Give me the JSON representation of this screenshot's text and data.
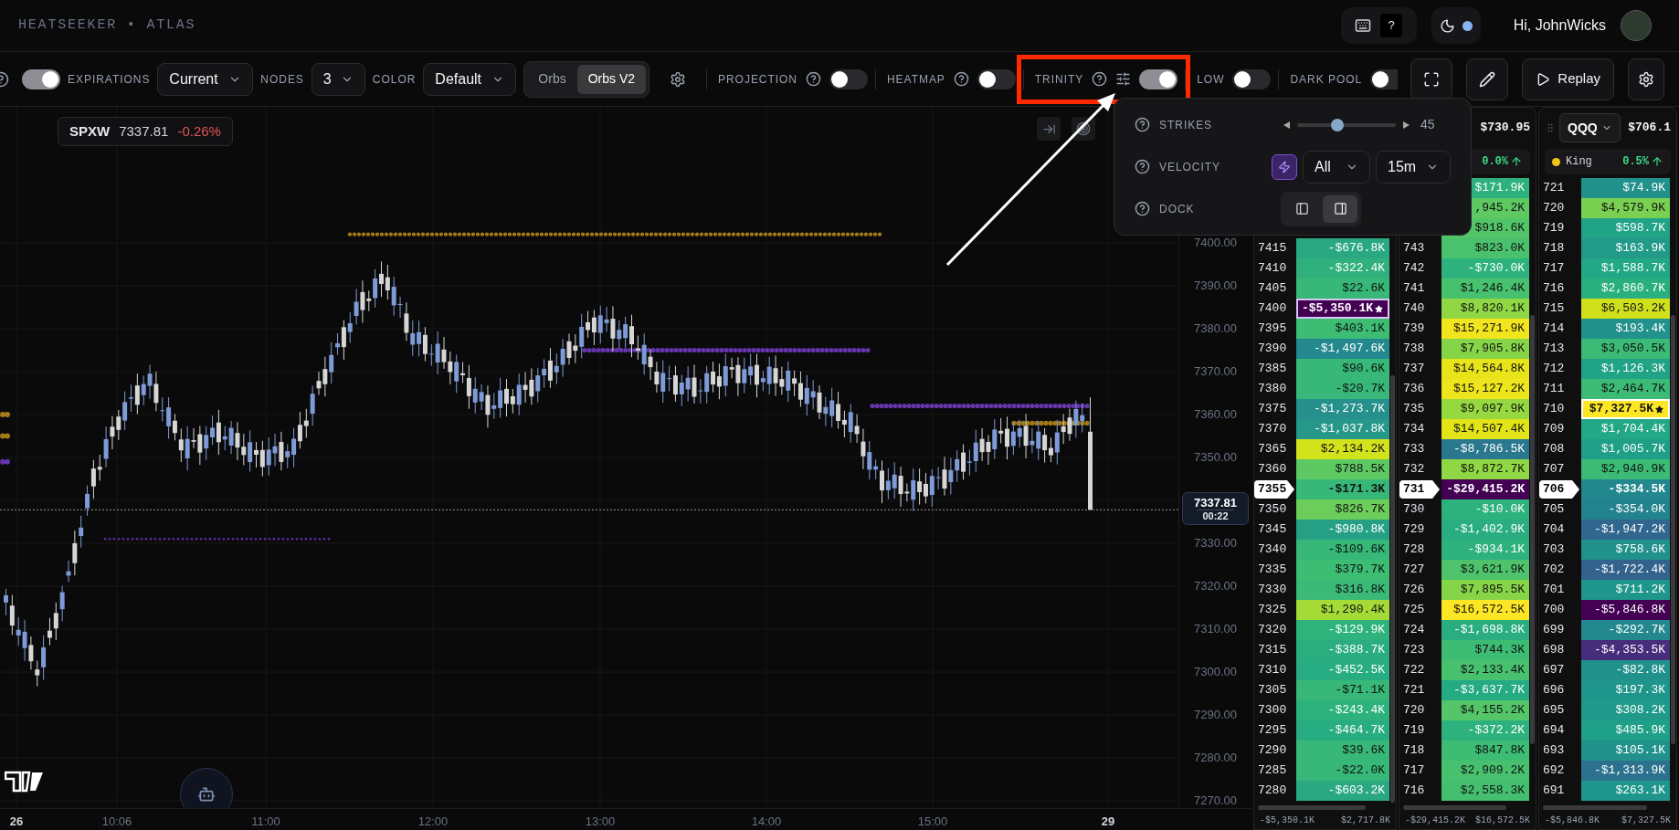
{
  "header": {
    "title": "HEATSEEKER • ATLAS",
    "help_key": "?",
    "greeting": "Hi, JohnWicks"
  },
  "toolbar": {
    "expirations": {
      "label": "EXPIRATIONS",
      "on": true,
      "value": "Current"
    },
    "nodes": {
      "label": "NODES",
      "value": "3"
    },
    "color": {
      "label": "COLOR",
      "value": "Default"
    },
    "modes": [
      {
        "label": "Orbs",
        "selected": false
      },
      {
        "label": "Orbs V2",
        "selected": true
      }
    ],
    "toggles": [
      {
        "label": "PROJECTION",
        "help": true,
        "settings": false,
        "on": false,
        "highlighted": false
      },
      {
        "label": "HEATMAP",
        "help": true,
        "settings": false,
        "on": false,
        "highlighted": false
      },
      {
        "label": "TRINITY",
        "help": true,
        "settings": true,
        "on": true,
        "highlighted": true
      },
      {
        "label": "LOW",
        "help": false,
        "settings": false,
        "on": false,
        "highlighted": false
      },
      {
        "label": "DARK POOL",
        "help": false,
        "settings": false,
        "on": false,
        "highlighted": false
      }
    ],
    "replay": "Replay"
  },
  "annotation": {
    "arrow": true
  },
  "popover": {
    "strikes": {
      "label": "STRIKES",
      "level": 0.41,
      "value": "45"
    },
    "velocity": {
      "label": "VELOCITY",
      "boost": true,
      "filter": "All",
      "window": "15m"
    },
    "dock": {
      "label": "DOCK",
      "options": [
        {
          "kind": "left",
          "selected": false
        },
        {
          "kind": "right",
          "selected": true
        }
      ]
    }
  },
  "chart": {
    "symbol": "SPXW",
    "price": "7337.81",
    "change": "-0.26%",
    "price_axis_upper": [
      "7400.00",
      "7390.00",
      "7380.00",
      "7370.00",
      "7360.00",
      "7350.00"
    ],
    "price_axis_lower": [
      "7330.00",
      "7320.00",
      "7310.00",
      "7300.00",
      "7290.00",
      "7280.00",
      "7270.00"
    ],
    "last_price": "7337.81",
    "countdown": "00:22",
    "time_axis": [
      {
        "label": "26",
        "major": true
      },
      {
        "label": "10:06",
        "major": false
      },
      {
        "label": "11:00",
        "major": false
      },
      {
        "label": "12:00",
        "major": false
      },
      {
        "label": "13:00",
        "major": false
      },
      {
        "label": "14:00",
        "major": false
      },
      {
        "label": "15:00",
        "major": false
      },
      {
        "label": "29",
        "major": true
      }
    ]
  },
  "panels": [
    {
      "rows": [
        {
          "strike": "7415",
          "value": "-$676.8K",
          "color": "#2aa882",
          "current": false,
          "marker": false
        },
        {
          "strike": "7410",
          "value": "-$322.4K",
          "color": "#30b07c",
          "current": false,
          "marker": false
        },
        {
          "strike": "7405",
          "value": "$22.6K",
          "color": "#37b878",
          "current": false,
          "marker": false
        },
        {
          "strike": "7400",
          "value": "-$5,350.1K",
          "color": "#440154",
          "current": false,
          "marker": true
        },
        {
          "strike": "7395",
          "value": "$403.1K",
          "color": "#3dbc74",
          "current": false,
          "marker": false
        },
        {
          "strike": "7390",
          "value": "-$1,497.6K",
          "color": "#23898e",
          "current": false,
          "marker": false
        },
        {
          "strike": "7385",
          "value": "$90.6K",
          "color": "#37b878",
          "current": false,
          "marker": false
        },
        {
          "strike": "7380",
          "value": "-$20.7K",
          "color": "#37b878",
          "current": false,
          "marker": false
        },
        {
          "strike": "7375",
          "value": "-$1,273.7K",
          "color": "#25908c",
          "current": false,
          "marker": false
        },
        {
          "strike": "7370",
          "value": "-$1,037.8K",
          "color": "#26988a",
          "current": false,
          "marker": false
        },
        {
          "strike": "7365",
          "value": "$2,134.2K",
          "color": "#d2e21b",
          "current": false,
          "marker": false
        },
        {
          "strike": "7360",
          "value": "$788.5K",
          "color": "#5ec962",
          "current": false,
          "marker": false
        },
        {
          "strike": "7355",
          "value": "-$171.3K",
          "color": "#37b878",
          "current": true,
          "marker": false
        },
        {
          "strike": "7350",
          "value": "$826.7K",
          "color": "#6ccd5a",
          "current": false,
          "marker": false
        },
        {
          "strike": "7345",
          "value": "-$980.8K",
          "color": "#25a085",
          "current": false,
          "marker": false
        },
        {
          "strike": "7340",
          "value": "-$109.6K",
          "color": "#37b878",
          "current": false,
          "marker": false
        },
        {
          "strike": "7335",
          "value": "$379.7K",
          "color": "#3dbc74",
          "current": false,
          "marker": false
        },
        {
          "strike": "7330",
          "value": "$316.8K",
          "color": "#3aba76",
          "current": false,
          "marker": false
        },
        {
          "strike": "7325",
          "value": "$1,290.4K",
          "color": "#a5db36",
          "current": false,
          "marker": false
        },
        {
          "strike": "7320",
          "value": "-$129.9K",
          "color": "#2eb37c",
          "current": false,
          "marker": false
        },
        {
          "strike": "7315",
          "value": "-$388.7K",
          "color": "#2aae80",
          "current": false,
          "marker": false
        },
        {
          "strike": "7310",
          "value": "-$452.5K",
          "color": "#28ac81",
          "current": false,
          "marker": false
        },
        {
          "strike": "7305",
          "value": "-$71.1K",
          "color": "#37b878",
          "current": false,
          "marker": false
        },
        {
          "strike": "7300",
          "value": "-$243.4K",
          "color": "#2db27d",
          "current": false,
          "marker": false
        },
        {
          "strike": "7295",
          "value": "-$464.7K",
          "color": "#28ac81",
          "current": false,
          "marker": false
        },
        {
          "strike": "7290",
          "value": "$39.6K",
          "color": "#37b878",
          "current": false,
          "marker": false
        },
        {
          "strike": "7285",
          "value": "-$22.0K",
          "color": "#37b878",
          "current": false,
          "marker": false
        },
        {
          "strike": "7280",
          "value": "-$603.2K",
          "color": "#2aa882",
          "current": false,
          "marker": false
        }
      ],
      "footer_min": "-$5,350.1K",
      "footer_max": "$2,717.8K"
    },
    {
      "price": "$730.95",
      "change": "0.0%",
      "rows": [
        {
          "value": "$171.9K",
          "color": "#2db27d",
          "current": false,
          "marker": false
        },
        {
          "value": ",945.2K",
          "color": "#5ec962",
          "current": false,
          "marker": false
        },
        {
          "value": "$918.6K",
          "color": "#52c569",
          "current": false,
          "marker": false
        },
        {
          "strike": "743",
          "value": "$823.0K",
          "color": "#4ac16d",
          "current": false,
          "marker": false
        },
        {
          "strike": "742",
          "value": "-$730.0K",
          "color": "#2db27d",
          "current": false,
          "marker": false
        },
        {
          "strike": "741",
          "value": "$1,246.4K",
          "color": "#48c16e",
          "current": false,
          "marker": false
        },
        {
          "strike": "740",
          "value": "$8,820.1K",
          "color": "#8fd744",
          "current": false,
          "marker": false
        },
        {
          "strike": "739",
          "value": "$15,271.9K",
          "color": "#f2e51d",
          "current": false,
          "marker": false
        },
        {
          "strike": "738",
          "value": "$7,905.8K",
          "color": "#86d549",
          "current": false,
          "marker": false
        },
        {
          "strike": "737",
          "value": "$14,564.8K",
          "color": "#e7e419",
          "current": false,
          "marker": false
        },
        {
          "strike": "736",
          "value": "$15,127.2K",
          "color": "#efe51c",
          "current": false,
          "marker": false
        },
        {
          "strike": "735",
          "value": "$9,097.9K",
          "color": "#95d840",
          "current": false,
          "marker": false
        },
        {
          "strike": "734",
          "value": "$14,507.4K",
          "color": "#e2e418",
          "current": false,
          "marker": false
        },
        {
          "strike": "733",
          "value": "-$8,786.5K",
          "color": "#2a788e",
          "current": false,
          "marker": false
        },
        {
          "strike": "732",
          "value": "$8,872.7K",
          "color": "#8fd744",
          "current": false,
          "marker": false
        },
        {
          "strike": "731",
          "value": "-$29,415.2K",
          "color": "#440154",
          "current": true,
          "marker": false
        },
        {
          "strike": "730",
          "value": "-$10.0K",
          "color": "#2db27d",
          "current": false,
          "marker": false
        },
        {
          "strike": "729",
          "value": "-$1,402.9K",
          "color": "#2aae80",
          "current": false,
          "marker": false
        },
        {
          "strike": "728",
          "value": "-$934.1K",
          "color": "#2db27d",
          "current": false,
          "marker": false
        },
        {
          "strike": "727",
          "value": "$3,621.9K",
          "color": "#4ec36b",
          "current": false,
          "marker": false
        },
        {
          "strike": "726",
          "value": "$7,895.5K",
          "color": "#86d549",
          "current": false,
          "marker": false
        },
        {
          "strike": "725",
          "value": "$16,572.5K",
          "color": "#fde725",
          "current": false,
          "marker": false
        },
        {
          "strike": "724",
          "value": "-$1,698.8K",
          "color": "#2aae80",
          "current": false,
          "marker": false
        },
        {
          "strike": "723",
          "value": "$744.3K",
          "color": "#3dbc74",
          "current": false,
          "marker": false
        },
        {
          "strike": "722",
          "value": "$2,133.4K",
          "color": "#48c16e",
          "current": false,
          "marker": false
        },
        {
          "strike": "721",
          "value": "-$3,637.7K",
          "color": "#25ab82",
          "current": false,
          "marker": false
        },
        {
          "strike": "720",
          "value": "$4,155.2K",
          "color": "#54c568",
          "current": false,
          "marker": false
        },
        {
          "strike": "719",
          "value": "-$372.2K",
          "color": "#2db27d",
          "current": false,
          "marker": false
        },
        {
          "strike": "718",
          "value": "$847.8K",
          "color": "#3dbc74",
          "current": false,
          "marker": false
        },
        {
          "strike": "717",
          "value": "$2,909.2K",
          "color": "#48c16e",
          "current": false,
          "marker": false
        },
        {
          "strike": "716",
          "value": "$2,558.3K",
          "color": "#44bf70",
          "current": false,
          "marker": false
        }
      ],
      "footer_min": "-$29,415.2K",
      "footer_max": "$16,572.5K"
    },
    {
      "ticker": "QQQ",
      "price": "$706.1",
      "tag": {
        "label": "King",
        "color": "#f5c518"
      },
      "change": "0.5%",
      "rows": [
        {
          "strike": "721",
          "value": "$74.9K",
          "color": "#21918c",
          "current": false,
          "marker": false
        },
        {
          "strike": "720",
          "value": "$4,579.9K",
          "color": "#7ad151",
          "current": false,
          "marker": false
        },
        {
          "strike": "719",
          "value": "$598.7K",
          "color": "#20a386",
          "current": false,
          "marker": false
        },
        {
          "strike": "718",
          "value": "$163.9K",
          "color": "#229a8a",
          "current": false,
          "marker": false
        },
        {
          "strike": "717",
          "value": "$1,588.7K",
          "color": "#22a884",
          "current": false,
          "marker": false
        },
        {
          "strike": "716",
          "value": "$2,860.7K",
          "color": "#2ab07f",
          "current": false,
          "marker": false
        },
        {
          "strike": "715",
          "value": "$6,503.2K",
          "color": "#d0e11c",
          "current": false,
          "marker": false
        },
        {
          "strike": "714",
          "value": "$193.4K",
          "color": "#21918c",
          "current": false,
          "marker": false
        },
        {
          "strike": "713",
          "value": "$3,050.5K",
          "color": "#3bbb75",
          "current": false,
          "marker": false
        },
        {
          "strike": "712",
          "value": "$1,126.3K",
          "color": "#20a386",
          "current": false,
          "marker": false
        },
        {
          "strike": "711",
          "value": "$2,464.7K",
          "color": "#3bbb75",
          "current": false,
          "marker": false
        },
        {
          "strike": "710",
          "value": "$7,327.5K",
          "color": "#fde725",
          "current": false,
          "marker": true
        },
        {
          "strike": "709",
          "value": "$1,704.4K",
          "color": "#22a884",
          "current": false,
          "marker": false
        },
        {
          "strike": "708",
          "value": "$1,005.7K",
          "color": "#1f9f88",
          "current": false,
          "marker": false
        },
        {
          "strike": "707",
          "value": "$2,940.9K",
          "color": "#3bbb75",
          "current": false,
          "marker": false
        },
        {
          "strike": "706",
          "value": "-$334.5K",
          "color": "#23888e",
          "current": true,
          "marker": false
        },
        {
          "strike": "705",
          "value": "-$354.0K",
          "color": "#22838e",
          "current": false,
          "marker": false
        },
        {
          "strike": "704",
          "value": "-$1,947.2K",
          "color": "#31668e",
          "current": false,
          "marker": false
        },
        {
          "strike": "703",
          "value": "$758.6K",
          "color": "#21918c",
          "current": false,
          "marker": false
        },
        {
          "strike": "702",
          "value": "-$1,722.4K",
          "color": "#33638d",
          "current": false,
          "marker": false
        },
        {
          "strike": "701",
          "value": "$711.2K",
          "color": "#1f968b",
          "current": false,
          "marker": false
        },
        {
          "strike": "700",
          "value": "-$5,846.8K",
          "color": "#440154",
          "current": false,
          "marker": false
        },
        {
          "strike": "699",
          "value": "-$292.7K",
          "color": "#23898e",
          "current": false,
          "marker": false
        },
        {
          "strike": "698",
          "value": "-$4,353.5K",
          "color": "#472d7b",
          "current": false,
          "marker": false
        },
        {
          "strike": "697",
          "value": "-$82.8K",
          "color": "#21918c",
          "current": false,
          "marker": false
        },
        {
          "strike": "696",
          "value": "$197.3K",
          "color": "#1f968b",
          "current": false,
          "marker": false
        },
        {
          "strike": "695",
          "value": "$308.2K",
          "color": "#1f9a8a",
          "current": false,
          "marker": false
        },
        {
          "strike": "694",
          "value": "$485.9K",
          "color": "#1fa088",
          "current": false,
          "marker": false
        },
        {
          "strike": "693",
          "value": "$105.1K",
          "color": "#21918c",
          "current": false,
          "marker": false
        },
        {
          "strike": "692",
          "value": "-$1,313.9K",
          "color": "#2c728e",
          "current": false,
          "marker": false
        },
        {
          "strike": "691",
          "value": "$263.1K",
          "color": "#1f968b",
          "current": false,
          "marker": false
        }
      ],
      "footer_min": "-$5,846.8K",
      "footer_max": "$7,327.5K"
    }
  ]
}
